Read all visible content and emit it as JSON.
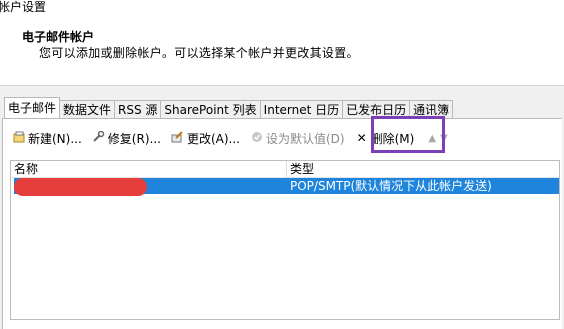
{
  "window": {
    "title": "帐户设置"
  },
  "header": {
    "title": "电子邮件帐户",
    "description": "您可以添加或删除帐户。可以选择某个帐户并更改其设置。"
  },
  "tabs": [
    {
      "label": "电子邮件",
      "active": true
    },
    {
      "label": "数据文件",
      "active": false
    },
    {
      "label": "RSS 源",
      "active": false
    },
    {
      "label": "SharePoint 列表",
      "active": false
    },
    {
      "label": "Internet 日历",
      "active": false
    },
    {
      "label": "已发布日历",
      "active": false
    },
    {
      "label": "通讯簿",
      "active": false
    }
  ],
  "toolbar": {
    "new_label": "新建(N)...",
    "repair_label": "修复(R)...",
    "change_label": "更改(A)...",
    "set_default_label": "设为默认值(D)",
    "remove_label": "删除(M)"
  },
  "list": {
    "columns": {
      "name": "名称",
      "type": "类型"
    },
    "rows": [
      {
        "name": "",
        "type": "POP/SMTP(默认情况下从此帐户发送)",
        "selected": true,
        "name_redacted": true
      }
    ]
  },
  "colors": {
    "selection": "#1e84dc",
    "highlight_box": "#7b3fb8",
    "redaction": "#e53c3c"
  },
  "icons": {
    "new": "new-account-icon",
    "repair": "repair-icon",
    "change": "change-icon",
    "set_default": "set-default-icon",
    "remove": "remove-x-icon",
    "move_up": "move-up-arrow-icon",
    "move_down": "move-down-arrow-icon"
  }
}
